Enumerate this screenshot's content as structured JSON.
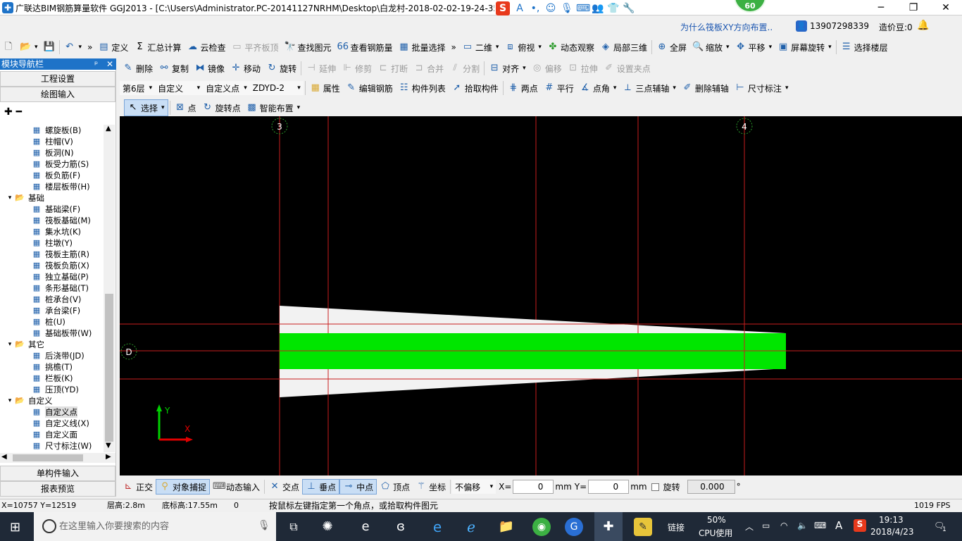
{
  "window": {
    "title": "广联达BIM钢筋算量软件 GGJ2013 - [C:\\Users\\Administrator.PC-20141127NRHM\\Desktop\\白龙村-2018-02-02-19-24-35",
    "badge": "60",
    "minimize": "─",
    "maximize": "❐",
    "close": "✕"
  },
  "infobar": {
    "link": "为什么筏板XY方向布置..",
    "user": "13907298339",
    "bean_label": "造价豆:0"
  },
  "toolbar1": {
    "items": [
      "定义",
      "汇总计算",
      "云检查",
      "平齐板顶",
      "查找图元",
      "查看钢筋量",
      "批量选择",
      "二维",
      "俯视",
      "动态观察",
      "局部三维",
      "全屏",
      "缩放",
      "平移",
      "屏幕旋转",
      "选择楼层"
    ]
  },
  "toolbar2": {
    "items": [
      "删除",
      "复制",
      "镜像",
      "移动",
      "旋转",
      "延伸",
      "修剪",
      "打断",
      "合并",
      "分割",
      "对齐",
      "偏移",
      "拉伸",
      "设置夹点"
    ]
  },
  "toolbar3": {
    "floor": "第6层",
    "type": "自定义",
    "subtype": "自定义点",
    "name": "ZDYD-2",
    "items": [
      "属性",
      "编辑钢筋",
      "构件列表",
      "拾取构件",
      "两点",
      "平行",
      "点角",
      "三点辅轴",
      "删除辅轴",
      "尺寸标注"
    ]
  },
  "toolbar4": {
    "items": [
      "选择",
      "点",
      "旋转点",
      "智能布置"
    ]
  },
  "panel": {
    "title": "模块导航栏",
    "pin": "ᵖ",
    "close": "✕",
    "btn_eng": "工程设置",
    "btn_draw": "绘图输入",
    "btn_single": "单构件输入",
    "btn_report": "报表预览",
    "tree": [
      {
        "label": "螺旋板(B)",
        "level": 2
      },
      {
        "label": "柱帽(V)",
        "level": 2
      },
      {
        "label": "板洞(N)",
        "level": 2
      },
      {
        "label": "板受力筋(S)",
        "level": 2
      },
      {
        "label": "板负筋(F)",
        "level": 2
      },
      {
        "label": "楼层板带(H)",
        "level": 2
      },
      {
        "label": "基础",
        "level": 1
      },
      {
        "label": "基础梁(F)",
        "level": 2
      },
      {
        "label": "筏板基础(M)",
        "level": 2
      },
      {
        "label": "集水坑(K)",
        "level": 2
      },
      {
        "label": "柱墩(Y)",
        "level": 2
      },
      {
        "label": "筏板主筋(R)",
        "level": 2
      },
      {
        "label": "筏板负筋(X)",
        "level": 2
      },
      {
        "label": "独立基础(P)",
        "level": 2
      },
      {
        "label": "条形基础(T)",
        "level": 2
      },
      {
        "label": "桩承台(V)",
        "level": 2
      },
      {
        "label": "承台梁(F)",
        "level": 2
      },
      {
        "label": "桩(U)",
        "level": 2
      },
      {
        "label": "基础板带(W)",
        "level": 2
      },
      {
        "label": "其它",
        "level": 1
      },
      {
        "label": "后浇带(JD)",
        "level": 2
      },
      {
        "label": "挑檐(T)",
        "level": 2
      },
      {
        "label": "栏板(K)",
        "level": 2
      },
      {
        "label": "压顶(YD)",
        "level": 2
      },
      {
        "label": "自定义",
        "level": 1
      },
      {
        "label": "自定义点",
        "level": 2
      },
      {
        "label": "自定义线(X)",
        "level": 2
      },
      {
        "label": "自定义面",
        "level": 2
      },
      {
        "label": "尺寸标注(W)",
        "level": 2
      }
    ]
  },
  "canvas": {
    "axis_labels": [
      "3",
      "4",
      "D"
    ],
    "ucs_y": "Y",
    "ucs_x": "X",
    "colors": {
      "bg": "#000000",
      "grid": "#c81e1e",
      "slab": "#f2f2f2",
      "band": "#00e600"
    }
  },
  "bottombar": {
    "items": [
      "正交",
      "对象捕捉",
      "动态输入",
      "交点",
      "垂点",
      "中点",
      "顶点",
      "坐标"
    ],
    "offset": "不偏移",
    "x_label": "X=",
    "x_value": "0",
    "y_label": "Y=",
    "y_value": "0",
    "unit": "mm",
    "rotate_label": "旋转",
    "rotate_value": "0.000",
    "degree": "°"
  },
  "status": {
    "coords": "X=10757 Y=12519",
    "floor_height": "层高:2.8m",
    "base_height": "底标高:17.55m",
    "zero": "0",
    "hint": "按鼠标左键指定第一个角点，或拾取构件图元",
    "fps": "1019 FPS"
  },
  "taskbar": {
    "search_placeholder": "在这里输入你要搜索的内容",
    "link": "链接",
    "cpu_pct": "50%",
    "cpu_label": "CPU使用",
    "ime": "A",
    "time": "19:13",
    "date": "2018/4/23",
    "notify": "1"
  }
}
